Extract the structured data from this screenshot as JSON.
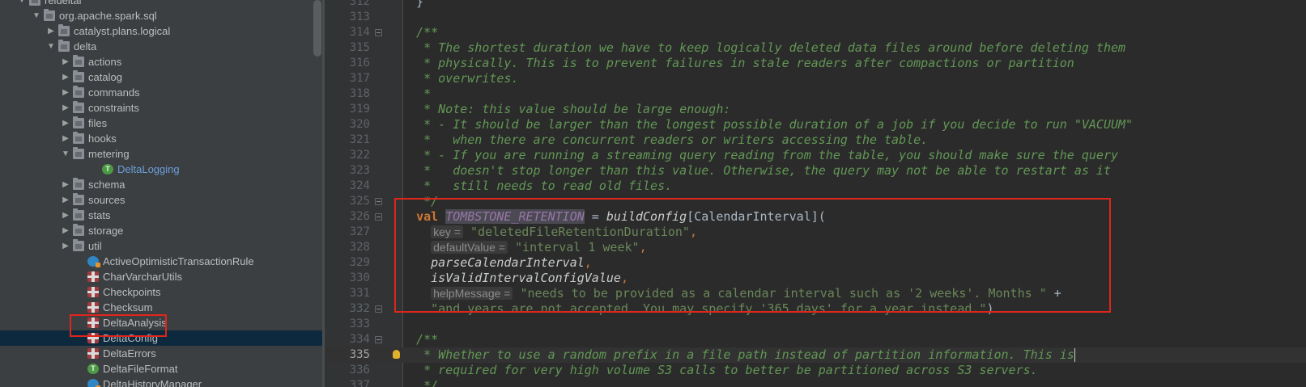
{
  "project_tree": {
    "rows": [
      {
        "label": "reldeltal",
        "indent": 0,
        "icon": "folder-icon",
        "chevron": "down"
      },
      {
        "label": "org.apache.spark.sql",
        "indent": 1,
        "icon": "folder-icon",
        "chevron": "down"
      },
      {
        "label": "catalyst.plans.logical",
        "indent": 2,
        "icon": "folder-icon",
        "chevron": "right"
      },
      {
        "label": "delta",
        "indent": 2,
        "icon": "folder-icon",
        "chevron": "down"
      },
      {
        "label": "actions",
        "indent": 3,
        "icon": "folder-icon",
        "chevron": "right"
      },
      {
        "label": "catalog",
        "indent": 3,
        "icon": "folder-icon",
        "chevron": "right"
      },
      {
        "label": "commands",
        "indent": 3,
        "icon": "folder-icon",
        "chevron": "right"
      },
      {
        "label": "constraints",
        "indent": 3,
        "icon": "folder-icon",
        "chevron": "right"
      },
      {
        "label": "files",
        "indent": 3,
        "icon": "folder-icon",
        "chevron": "right"
      },
      {
        "label": "hooks",
        "indent": 3,
        "icon": "folder-icon",
        "chevron": "right"
      },
      {
        "label": "metering",
        "indent": 3,
        "icon": "folder-icon",
        "chevron": "down"
      },
      {
        "label": "DeltaLogging",
        "indent": 5,
        "icon": "trait-icon",
        "chevron": "",
        "blue": true
      },
      {
        "label": "schema",
        "indent": 3,
        "icon": "folder-icon",
        "chevron": "right"
      },
      {
        "label": "sources",
        "indent": 3,
        "icon": "folder-icon",
        "chevron": "right"
      },
      {
        "label": "stats",
        "indent": 3,
        "icon": "folder-icon",
        "chevron": "right"
      },
      {
        "label": "storage",
        "indent": 3,
        "icon": "folder-icon",
        "chevron": "right"
      },
      {
        "label": "util",
        "indent": 3,
        "icon": "folder-icon",
        "chevron": "right"
      },
      {
        "label": "ActiveOptimisticTransactionRule",
        "indent": 4,
        "icon": "class-icon",
        "chevron": ""
      },
      {
        "label": "CharVarcharUtils",
        "indent": 4,
        "icon": "object-icon",
        "chevron": ""
      },
      {
        "label": "Checkpoints",
        "indent": 4,
        "icon": "object-icon",
        "chevron": ""
      },
      {
        "label": "Checksum",
        "indent": 4,
        "icon": "object-icon",
        "chevron": ""
      },
      {
        "label": "DeltaAnalysis",
        "indent": 4,
        "icon": "object-icon",
        "chevron": ""
      },
      {
        "label": "DeltaConfig",
        "indent": 4,
        "icon": "object-icon",
        "chevron": "",
        "selected": true
      },
      {
        "label": "DeltaErrors",
        "indent": 4,
        "icon": "object-icon",
        "chevron": ""
      },
      {
        "label": "DeltaFileFormat",
        "indent": 4,
        "icon": "trait-icon",
        "chevron": ""
      },
      {
        "label": "DeltaHistoryManager",
        "indent": 4,
        "icon": "class-icon",
        "chevron": ""
      }
    ]
  },
  "editor": {
    "lines": [
      {
        "n": "312",
        "fold": false,
        "tokens": [
          {
            "t": "  }",
            "c": "c-plain"
          }
        ]
      },
      {
        "n": "313",
        "fold": false,
        "tokens": []
      },
      {
        "n": "314",
        "fold": true,
        "tokens": [
          {
            "t": "  /**",
            "c": "c-doc"
          }
        ]
      },
      {
        "n": "315",
        "fold": false,
        "tokens": [
          {
            "t": "   * The shortest duration we have to keep logically deleted data files around before deleting them",
            "c": "c-doc"
          }
        ]
      },
      {
        "n": "316",
        "fold": false,
        "tokens": [
          {
            "t": "   * physically. This is to prevent failures in stale readers after compactions or partition",
            "c": "c-doc"
          }
        ]
      },
      {
        "n": "317",
        "fold": false,
        "tokens": [
          {
            "t": "   * overwrites.",
            "c": "c-doc"
          }
        ]
      },
      {
        "n": "318",
        "fold": false,
        "tokens": [
          {
            "t": "   *",
            "c": "c-doc"
          }
        ]
      },
      {
        "n": "319",
        "fold": false,
        "tokens": [
          {
            "t": "   * Note: this value should be large enough:",
            "c": "c-doc"
          }
        ]
      },
      {
        "n": "320",
        "fold": false,
        "tokens": [
          {
            "t": "   * - It should be larger than the longest possible duration of a job if you decide to run \"VACUUM\"",
            "c": "c-doc"
          }
        ]
      },
      {
        "n": "321",
        "fold": false,
        "tokens": [
          {
            "t": "   *   when there are concurrent readers or writers accessing the table.",
            "c": "c-doc"
          }
        ]
      },
      {
        "n": "322",
        "fold": false,
        "tokens": [
          {
            "t": "   * - If you are running a streaming query reading from the table, you should make sure the query",
            "c": "c-doc"
          }
        ]
      },
      {
        "n": "323",
        "fold": false,
        "tokens": [
          {
            "t": "   *   doesn't stop longer than this value. Otherwise, the query may not be able to restart as it",
            "c": "c-doc"
          }
        ]
      },
      {
        "n": "324",
        "fold": false,
        "tokens": [
          {
            "t": "   *   still needs to read old files.",
            "c": "c-doc"
          }
        ]
      },
      {
        "n": "325",
        "fold": true,
        "tokens": [
          {
            "t": "   */",
            "c": "c-doc"
          }
        ]
      },
      {
        "n": "326",
        "fold": true,
        "tokens": [
          {
            "t": "  ",
            "c": "c-plain"
          },
          {
            "t": "val",
            "c": "c-kw"
          },
          {
            "t": " ",
            "c": "c-plain"
          },
          {
            "t": "TOMBSTONE_RETENTION",
            "c": "c-const"
          },
          {
            "t": " = ",
            "c": "c-plain"
          },
          {
            "t": "buildConfig",
            "c": "c-fn"
          },
          {
            "t": "[CalendarInterval](",
            "c": "c-plain"
          }
        ]
      },
      {
        "n": "327",
        "fold": false,
        "tokens": [
          {
            "t": "    ",
            "c": "c-plain"
          },
          {
            "t": "key =",
            "c": "hint"
          },
          {
            "t": " ",
            "c": "c-plain"
          },
          {
            "t": "\"deletedFileRetentionDuration\"",
            "c": "c-str"
          },
          {
            "t": ",",
            "c": "c-punc"
          }
        ]
      },
      {
        "n": "328",
        "fold": false,
        "tokens": [
          {
            "t": "    ",
            "c": "c-plain"
          },
          {
            "t": "defaultValue =",
            "c": "hint"
          },
          {
            "t": " ",
            "c": "c-plain"
          },
          {
            "t": "\"interval 1 week\"",
            "c": "c-str"
          },
          {
            "t": ",",
            "c": "c-punc"
          }
        ]
      },
      {
        "n": "329",
        "fold": false,
        "tokens": [
          {
            "t": "    ",
            "c": "c-plain"
          },
          {
            "t": "parseCalendarInterval",
            "c": "c-fn"
          },
          {
            "t": ",",
            "c": "c-punc"
          }
        ]
      },
      {
        "n": "330",
        "fold": false,
        "tokens": [
          {
            "t": "    ",
            "c": "c-plain"
          },
          {
            "t": "isValidIntervalConfigValue",
            "c": "c-fn"
          },
          {
            "t": ",",
            "c": "c-punc"
          }
        ]
      },
      {
        "n": "331",
        "fold": false,
        "tokens": [
          {
            "t": "    ",
            "c": "c-plain"
          },
          {
            "t": "helpMessage =",
            "c": "hint"
          },
          {
            "t": " ",
            "c": "c-plain"
          },
          {
            "t": "\"needs to be provided as a calendar interval such as '2 weeks'. Months \"",
            "c": "c-str"
          },
          {
            "t": " +",
            "c": "c-plain"
          }
        ]
      },
      {
        "n": "332",
        "fold": true,
        "tokens": [
          {
            "t": "    ",
            "c": "c-plain"
          },
          {
            "t": "\"and years are not accepted. You may specify '365 days' for a year instead.\"",
            "c": "c-str"
          },
          {
            "t": ")",
            "c": "c-plain"
          }
        ]
      },
      {
        "n": "333",
        "fold": false,
        "tokens": []
      },
      {
        "n": "334",
        "fold": true,
        "tokens": [
          {
            "t": "  /**",
            "c": "c-doc"
          }
        ]
      },
      {
        "n": "335",
        "fold": false,
        "current": true,
        "bulb": true,
        "tokens": [
          {
            "t": "   * Whether to use a random prefix in a file path instead of partition information. This is",
            "c": "c-doc"
          },
          {
            "t": "",
            "c": "caret"
          }
        ]
      },
      {
        "n": "336",
        "fold": false,
        "tokens": [
          {
            "t": "   * required for very high volume S3 calls to better be partitioned across S3 servers.",
            "c": "c-doc"
          }
        ]
      },
      {
        "n": "337",
        "fold": false,
        "tokens": [
          {
            "t": "   */",
            "c": "c-doc"
          }
        ]
      }
    ]
  }
}
